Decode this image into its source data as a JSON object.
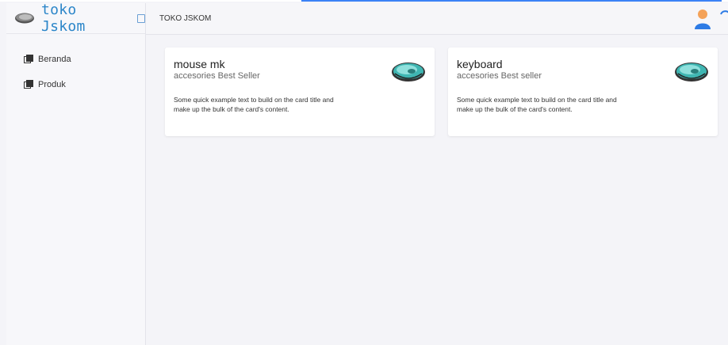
{
  "brand": {
    "title": "toko Jskom",
    "icon": "mouse-icon"
  },
  "sidebar": {
    "items": [
      {
        "label": "Beranda",
        "icon": "copy-icon"
      },
      {
        "label": "Produk",
        "icon": "copy-icon"
      }
    ]
  },
  "header": {
    "title": "TOKO JSKOM",
    "avatar_icon": "user-avatar-icon",
    "spinner_icon": "loading-spinner-icon"
  },
  "cards": [
    {
      "title": "mouse mk",
      "subtitle": "accesories Best Seller",
      "text": "Some quick example text to build on the card title and make up the bulk of the card's content.",
      "image": "mouse-icon"
    },
    {
      "title": "keyboard",
      "subtitle": "accesories Best seller",
      "text": "Some quick example text to build on the card title and make up the bulk of the card's content.",
      "image": "mouse-icon"
    }
  ],
  "colors": {
    "accent": "#3b82f6",
    "brand_text": "#2c86c9",
    "mouse_teal": "#3fb6b2"
  }
}
